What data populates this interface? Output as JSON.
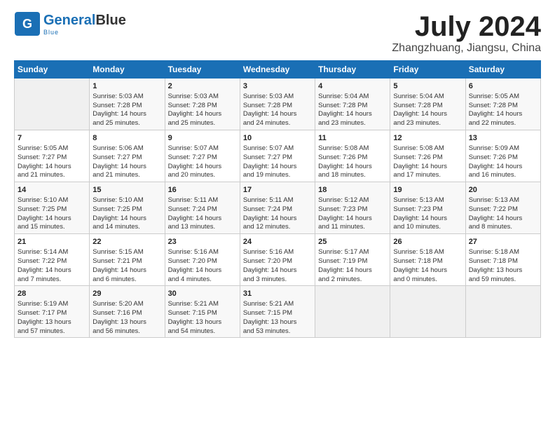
{
  "logo": {
    "part1": "General",
    "part2": "Blue"
  },
  "title": "July 2024",
  "subtitle": "Zhangzhuang, Jiangsu, China",
  "days_header": [
    "Sunday",
    "Monday",
    "Tuesday",
    "Wednesday",
    "Thursday",
    "Friday",
    "Saturday"
  ],
  "weeks": [
    [
      {
        "day": "",
        "lines": []
      },
      {
        "day": "1",
        "lines": [
          "Sunrise: 5:03 AM",
          "Sunset: 7:28 PM",
          "Daylight: 14 hours",
          "and 25 minutes."
        ]
      },
      {
        "day": "2",
        "lines": [
          "Sunrise: 5:03 AM",
          "Sunset: 7:28 PM",
          "Daylight: 14 hours",
          "and 25 minutes."
        ]
      },
      {
        "day": "3",
        "lines": [
          "Sunrise: 5:03 AM",
          "Sunset: 7:28 PM",
          "Daylight: 14 hours",
          "and 24 minutes."
        ]
      },
      {
        "day": "4",
        "lines": [
          "Sunrise: 5:04 AM",
          "Sunset: 7:28 PM",
          "Daylight: 14 hours",
          "and 23 minutes."
        ]
      },
      {
        "day": "5",
        "lines": [
          "Sunrise: 5:04 AM",
          "Sunset: 7:28 PM",
          "Daylight: 14 hours",
          "and 23 minutes."
        ]
      },
      {
        "day": "6",
        "lines": [
          "Sunrise: 5:05 AM",
          "Sunset: 7:28 PM",
          "Daylight: 14 hours",
          "and 22 minutes."
        ]
      }
    ],
    [
      {
        "day": "7",
        "lines": [
          "Sunrise: 5:05 AM",
          "Sunset: 7:27 PM",
          "Daylight: 14 hours",
          "and 21 minutes."
        ]
      },
      {
        "day": "8",
        "lines": [
          "Sunrise: 5:06 AM",
          "Sunset: 7:27 PM",
          "Daylight: 14 hours",
          "and 21 minutes."
        ]
      },
      {
        "day": "9",
        "lines": [
          "Sunrise: 5:07 AM",
          "Sunset: 7:27 PM",
          "Daylight: 14 hours",
          "and 20 minutes."
        ]
      },
      {
        "day": "10",
        "lines": [
          "Sunrise: 5:07 AM",
          "Sunset: 7:27 PM",
          "Daylight: 14 hours",
          "and 19 minutes."
        ]
      },
      {
        "day": "11",
        "lines": [
          "Sunrise: 5:08 AM",
          "Sunset: 7:26 PM",
          "Daylight: 14 hours",
          "and 18 minutes."
        ]
      },
      {
        "day": "12",
        "lines": [
          "Sunrise: 5:08 AM",
          "Sunset: 7:26 PM",
          "Daylight: 14 hours",
          "and 17 minutes."
        ]
      },
      {
        "day": "13",
        "lines": [
          "Sunrise: 5:09 AM",
          "Sunset: 7:26 PM",
          "Daylight: 14 hours",
          "and 16 minutes."
        ]
      }
    ],
    [
      {
        "day": "14",
        "lines": [
          "Sunrise: 5:10 AM",
          "Sunset: 7:25 PM",
          "Daylight: 14 hours",
          "and 15 minutes."
        ]
      },
      {
        "day": "15",
        "lines": [
          "Sunrise: 5:10 AM",
          "Sunset: 7:25 PM",
          "Daylight: 14 hours",
          "and 14 minutes."
        ]
      },
      {
        "day": "16",
        "lines": [
          "Sunrise: 5:11 AM",
          "Sunset: 7:24 PM",
          "Daylight: 14 hours",
          "and 13 minutes."
        ]
      },
      {
        "day": "17",
        "lines": [
          "Sunrise: 5:11 AM",
          "Sunset: 7:24 PM",
          "Daylight: 14 hours",
          "and 12 minutes."
        ]
      },
      {
        "day": "18",
        "lines": [
          "Sunrise: 5:12 AM",
          "Sunset: 7:23 PM",
          "Daylight: 14 hours",
          "and 11 minutes."
        ]
      },
      {
        "day": "19",
        "lines": [
          "Sunrise: 5:13 AM",
          "Sunset: 7:23 PM",
          "Daylight: 14 hours",
          "and 10 minutes."
        ]
      },
      {
        "day": "20",
        "lines": [
          "Sunrise: 5:13 AM",
          "Sunset: 7:22 PM",
          "Daylight: 14 hours",
          "and 8 minutes."
        ]
      }
    ],
    [
      {
        "day": "21",
        "lines": [
          "Sunrise: 5:14 AM",
          "Sunset: 7:22 PM",
          "Daylight: 14 hours",
          "and 7 minutes."
        ]
      },
      {
        "day": "22",
        "lines": [
          "Sunrise: 5:15 AM",
          "Sunset: 7:21 PM",
          "Daylight: 14 hours",
          "and 6 minutes."
        ]
      },
      {
        "day": "23",
        "lines": [
          "Sunrise: 5:16 AM",
          "Sunset: 7:20 PM",
          "Daylight: 14 hours",
          "and 4 minutes."
        ]
      },
      {
        "day": "24",
        "lines": [
          "Sunrise: 5:16 AM",
          "Sunset: 7:20 PM",
          "Daylight: 14 hours",
          "and 3 minutes."
        ]
      },
      {
        "day": "25",
        "lines": [
          "Sunrise: 5:17 AM",
          "Sunset: 7:19 PM",
          "Daylight: 14 hours",
          "and 2 minutes."
        ]
      },
      {
        "day": "26",
        "lines": [
          "Sunrise: 5:18 AM",
          "Sunset: 7:18 PM",
          "Daylight: 14 hours",
          "and 0 minutes."
        ]
      },
      {
        "day": "27",
        "lines": [
          "Sunrise: 5:18 AM",
          "Sunset: 7:18 PM",
          "Daylight: 13 hours",
          "and 59 minutes."
        ]
      }
    ],
    [
      {
        "day": "28",
        "lines": [
          "Sunrise: 5:19 AM",
          "Sunset: 7:17 PM",
          "Daylight: 13 hours",
          "and 57 minutes."
        ]
      },
      {
        "day": "29",
        "lines": [
          "Sunrise: 5:20 AM",
          "Sunset: 7:16 PM",
          "Daylight: 13 hours",
          "and 56 minutes."
        ]
      },
      {
        "day": "30",
        "lines": [
          "Sunrise: 5:21 AM",
          "Sunset: 7:15 PM",
          "Daylight: 13 hours",
          "and 54 minutes."
        ]
      },
      {
        "day": "31",
        "lines": [
          "Sunrise: 5:21 AM",
          "Sunset: 7:15 PM",
          "Daylight: 13 hours",
          "and 53 minutes."
        ]
      },
      {
        "day": "",
        "lines": []
      },
      {
        "day": "",
        "lines": []
      },
      {
        "day": "",
        "lines": []
      }
    ]
  ]
}
